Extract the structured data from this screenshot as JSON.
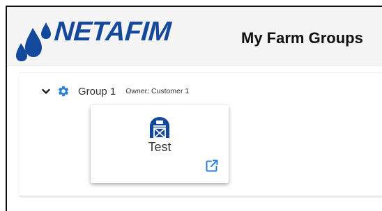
{
  "header": {
    "logo_text": "NETAFIM",
    "page_title": "My Farm Groups"
  },
  "groups": [
    {
      "name": "Group 1",
      "owner": "Owner: Customer 1",
      "expanded": true,
      "farms": [
        {
          "name": "Test",
          "icon": "barn-icon",
          "action_icon": "external-link-icon"
        }
      ]
    }
  ],
  "colors": {
    "brand_blue": "#14489a",
    "accent_blue": "#2b7fd8",
    "header_bg": "#f4f4f4"
  }
}
